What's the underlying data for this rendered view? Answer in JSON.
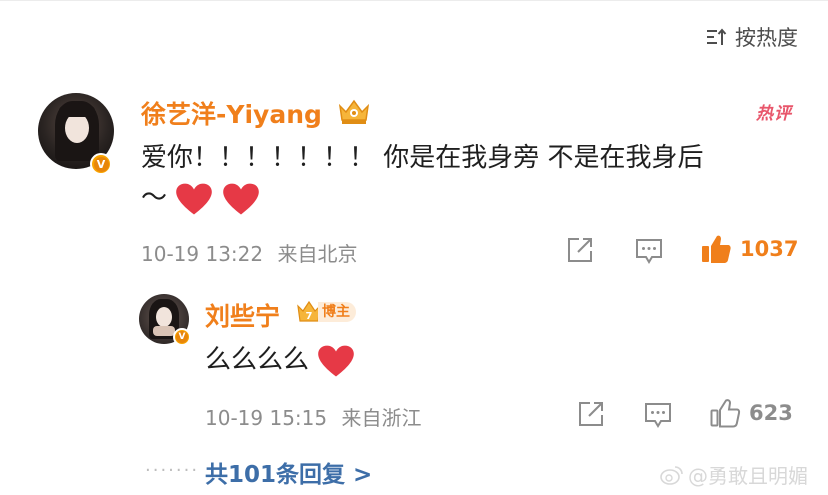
{
  "sort": {
    "label": "按热度"
  },
  "comment": {
    "username": "徐艺洋-Yiyang",
    "hot_tag": "热评",
    "text_line1": "爱你！！！！！！！ 你是在我身旁 不是在我身后",
    "text_line2": "～",
    "time": "10-19 13:22",
    "location": "来自北京",
    "likes": "1037",
    "liked": true
  },
  "reply": {
    "username": "刘些宁",
    "badge": "博主",
    "badge_level": "7",
    "text": "么么么么",
    "time": "10-19 15:15",
    "location": "来自浙江",
    "likes": "623",
    "liked": false
  },
  "more_replies": {
    "label": "共101条回复 >"
  },
  "watermark": "@勇敢且明媚",
  "colors": {
    "accent_orange": "#f07f1b",
    "link_blue": "#3d6ea8",
    "heart_red": "#e63946",
    "meta_gray": "#8c8c8c"
  }
}
